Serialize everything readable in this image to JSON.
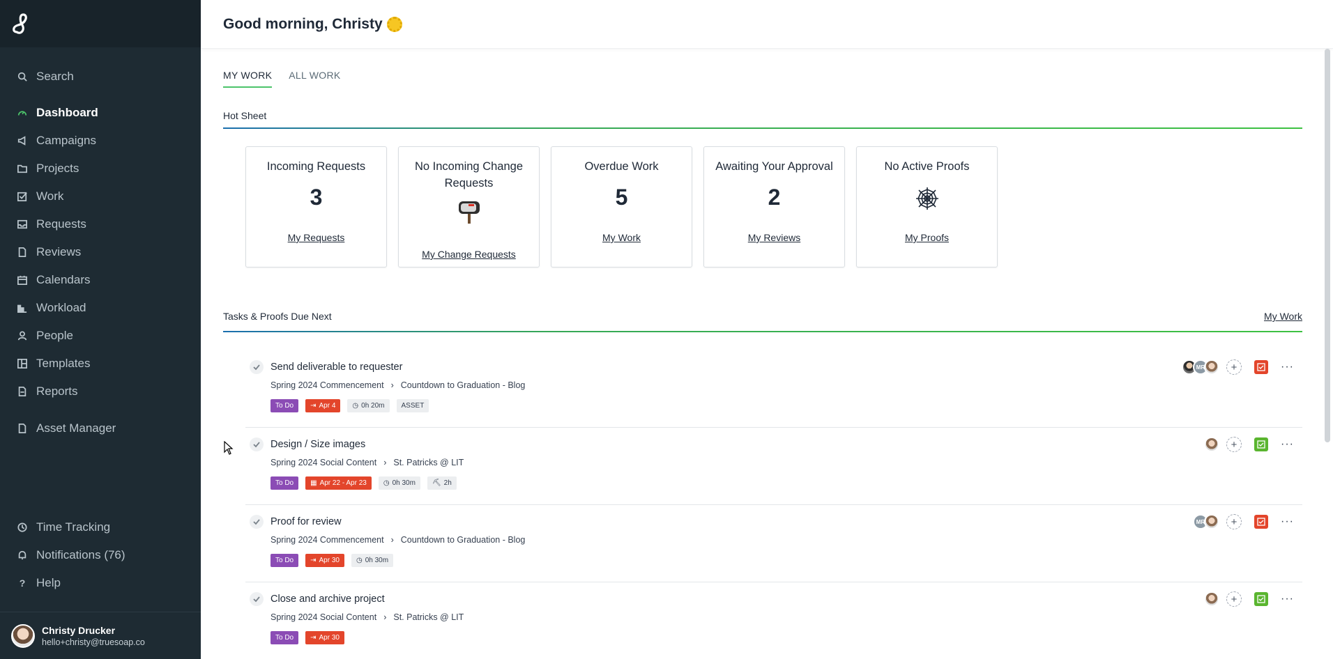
{
  "sidebar": {
    "logo": "brand-logo-icon",
    "search": "Search",
    "items": [
      {
        "label": "Dashboard",
        "icon": "gauge-icon",
        "active": true
      },
      {
        "label": "Campaigns",
        "icon": "megaphone-icon"
      },
      {
        "label": "Projects",
        "icon": "folder-icon"
      },
      {
        "label": "Work",
        "icon": "checkbox-icon"
      },
      {
        "label": "Requests",
        "icon": "inbox-icon"
      },
      {
        "label": "Reviews",
        "icon": "file-icon"
      },
      {
        "label": "Calendars",
        "icon": "calendar-icon"
      },
      {
        "label": "Workload",
        "icon": "bar-chart-icon"
      },
      {
        "label": "People",
        "icon": "person-icon"
      },
      {
        "label": "Templates",
        "icon": "template-icon"
      },
      {
        "label": "Reports",
        "icon": "file-icon"
      }
    ],
    "asset_manager": "Asset Manager",
    "bottom": [
      {
        "label": "Time Tracking",
        "icon": "clock-icon"
      },
      {
        "label": "Notifications (76)",
        "icon": "bell-icon"
      },
      {
        "label": "Help",
        "icon": "question-icon"
      }
    ],
    "user": {
      "name": "Christy Drucker",
      "email": "hello+christy@truesoap.co"
    }
  },
  "header": {
    "greeting": "Good morning, Christy"
  },
  "tabs": [
    {
      "label": "MY WORK",
      "active": true
    },
    {
      "label": "ALL WORK"
    }
  ],
  "hot_sheet": {
    "title": "Hot Sheet",
    "cards": [
      {
        "title": "Incoming Requests",
        "value": "3",
        "link": "My Requests"
      },
      {
        "title": "No Incoming Change Requests",
        "icon": "mailbox-icon",
        "link": "My Change Requests"
      },
      {
        "title": "Overdue Work",
        "value": "5",
        "link": "My Work"
      },
      {
        "title": "Awaiting Your Approval",
        "value": "2",
        "link": "My Reviews"
      },
      {
        "title": "No Active Proofs",
        "icon": "spiderweb-icon",
        "link": "My Proofs"
      }
    ]
  },
  "tasks_section": {
    "title": "Tasks & Proofs Due Next",
    "link": "My Work",
    "tasks": [
      {
        "title": "Send deliverable to requester",
        "project": "Spring 2024 Commencement",
        "item": "Countdown to Graduation - Blog",
        "status": "To Do",
        "due": "Apr 4",
        "time": "0h 20m",
        "extra": "ASSET",
        "status_color": "#e3452b"
      },
      {
        "title": "Design / Size images",
        "project": "Spring 2024 Social Content",
        "item": "St. Patricks @ LIT",
        "status": "To Do",
        "due": "Apr 22 - Apr 23",
        "time": "0h 30m",
        "extra": "2h",
        "status_color": "#5ab52f"
      },
      {
        "title": "Proof for review",
        "project": "Spring 2024 Commencement",
        "item": "Countdown to Graduation - Blog",
        "status": "To Do",
        "due": "Apr 30",
        "time": "0h 30m",
        "status_color": "#e3452b"
      },
      {
        "title": "Close and archive project",
        "project": "Spring 2024 Social Content",
        "item": "St. Patricks @ LIT",
        "status": "To Do",
        "due": "Apr 30",
        "status_color": "#5ab52f"
      }
    ]
  },
  "avatars": {
    "mr_initials": "MR"
  }
}
